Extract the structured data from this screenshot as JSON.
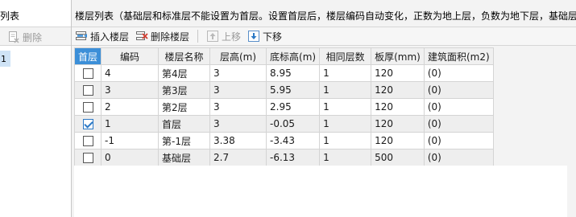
{
  "left": {
    "title": "列表",
    "delete_label": "删除",
    "selected_marker": "1"
  },
  "right": {
    "title": "楼层列表（基础层和标准层不能设置为首层。设置首层后，楼层编码自动变化，正数为地上层，负数为地下层，基础层"
  },
  "toolbar": {
    "insert_label": "插入楼层",
    "delete_label": "删除楼层",
    "up_label": "上移",
    "down_label": "下移"
  },
  "grid": {
    "headers": [
      "首层",
      "编码",
      "楼层名称",
      "层高(m)",
      "底标高(m)",
      "相同层数",
      "板厚(mm)",
      "建筑面积(m2)"
    ],
    "rows": [
      {
        "first": false,
        "code": "4",
        "name": "第4层",
        "height": "3",
        "bottom": "8.95",
        "same": "1",
        "slab": "120",
        "area": "(0)"
      },
      {
        "first": false,
        "code": "3",
        "name": "第3层",
        "height": "3",
        "bottom": "5.95",
        "same": "1",
        "slab": "120",
        "area": "(0)"
      },
      {
        "first": false,
        "code": "2",
        "name": "第2层",
        "height": "3",
        "bottom": "2.95",
        "same": "1",
        "slab": "120",
        "area": "(0)"
      },
      {
        "first": true,
        "code": "1",
        "name": "首层",
        "height": "3",
        "bottom": "-0.05",
        "same": "1",
        "slab": "120",
        "area": "(0)"
      },
      {
        "first": false,
        "code": "-1",
        "name": "第-1层",
        "height": "3.38",
        "bottom": "-3.43",
        "same": "1",
        "slab": "120",
        "area": "(0)"
      },
      {
        "first": false,
        "code": "0",
        "name": "基础层",
        "height": "2.7",
        "bottom": "-6.13",
        "same": "1",
        "slab": "500",
        "area": "(0)"
      }
    ]
  },
  "colors": {
    "accent": "#3c8fd8",
    "check": "#2b78c5"
  }
}
